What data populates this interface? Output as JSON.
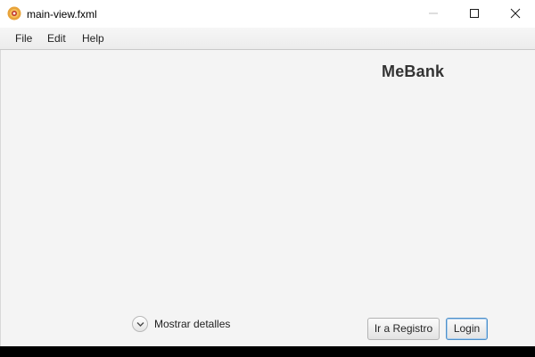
{
  "window": {
    "title": "main-view.fxml",
    "icon": "app-logo-icon",
    "controls": [
      "minimize-icon",
      "maximize-icon",
      "close-icon"
    ]
  },
  "menubar": {
    "items": [
      {
        "label": "File"
      },
      {
        "label": "Edit"
      },
      {
        "label": "Help"
      }
    ]
  },
  "main": {
    "brand": "MeBank",
    "details_toggle": {
      "label": "Mostrar detalles",
      "icon": "chevron-down-icon"
    },
    "buttons": {
      "register_label": "Ir a Registro",
      "login_label": "Login"
    }
  },
  "colors": {
    "background": "#f4f4f4",
    "focus_border": "#4e90c9",
    "brand_text": "#333333",
    "app_icon": "#e8a33a"
  }
}
